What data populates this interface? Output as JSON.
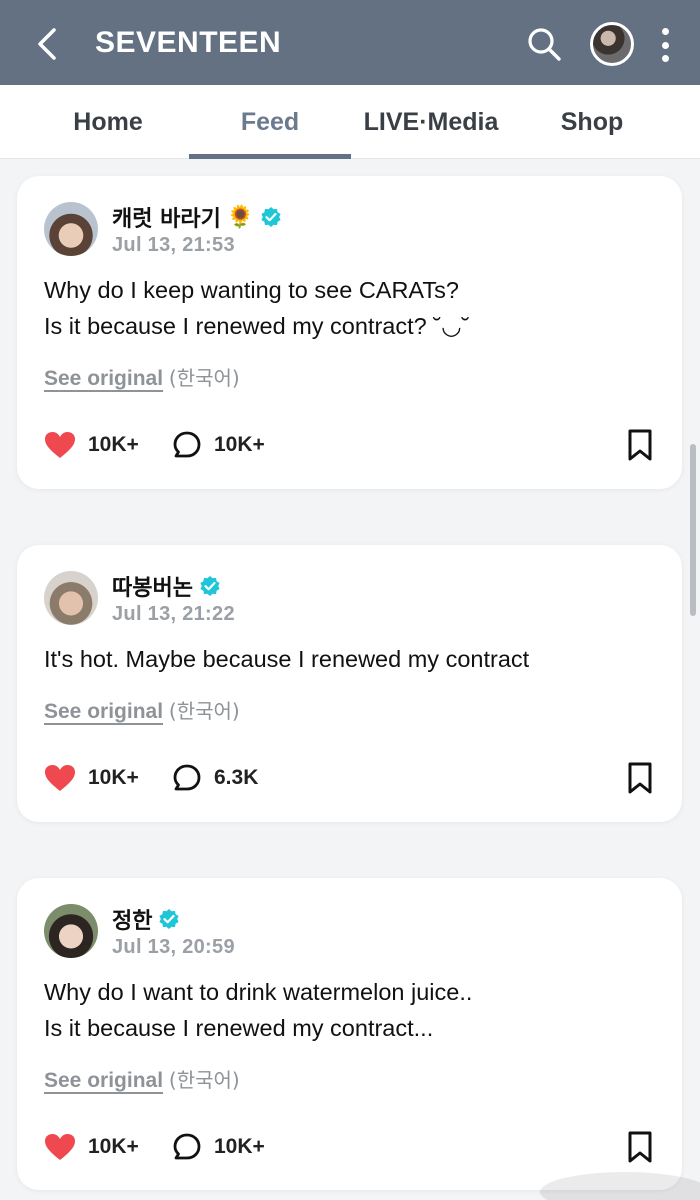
{
  "header": {
    "title": "SEVENTEEN",
    "bg_color": "#637182"
  },
  "tabs": [
    {
      "label": "Home",
      "active": false
    },
    {
      "label": "Feed",
      "active": true
    },
    {
      "label": "LIVE·Media",
      "active": false
    },
    {
      "label": "Shop",
      "active": false
    }
  ],
  "posts": [
    {
      "author": "캐럿 바라기",
      "author_emoji": "🌻",
      "verified": true,
      "timestamp": "Jul 13, 21:53",
      "lines": [
        "Why do I keep wanting to see CARATs?",
        "Is it because I renewed my contract? ˘◡˘"
      ],
      "see_original": "See original",
      "language_note": "(한국어)",
      "likes": "10K+",
      "comments": "10K+"
    },
    {
      "author": "따봉버논",
      "verified": true,
      "timestamp": "Jul 13, 21:22",
      "lines": [
        "It's hot. Maybe because I renewed my contract"
      ],
      "see_original": "See original",
      "language_note": "(한국어)",
      "likes": "10K+",
      "comments": "6.3K"
    },
    {
      "author": "정한",
      "verified": true,
      "timestamp": "Jul 13, 20:59",
      "lines": [
        "Why do I want to drink watermelon juice..",
        "Is it because I renewed my contract..."
      ],
      "see_original": "See original",
      "language_note": "(한국어)",
      "likes": "10K+",
      "comments": "10K+"
    }
  ],
  "icons": {
    "back": "chevron-left-icon",
    "search": "search-icon",
    "more": "more-vertical-icon",
    "verified": "verified-badge-icon",
    "like": "heart-icon",
    "comment": "comment-bubble-icon",
    "bookmark": "bookmark-icon"
  },
  "colors": {
    "like": "#f0484f",
    "verified": "#1ec6d8",
    "tab_active": "#6b7a8c"
  }
}
